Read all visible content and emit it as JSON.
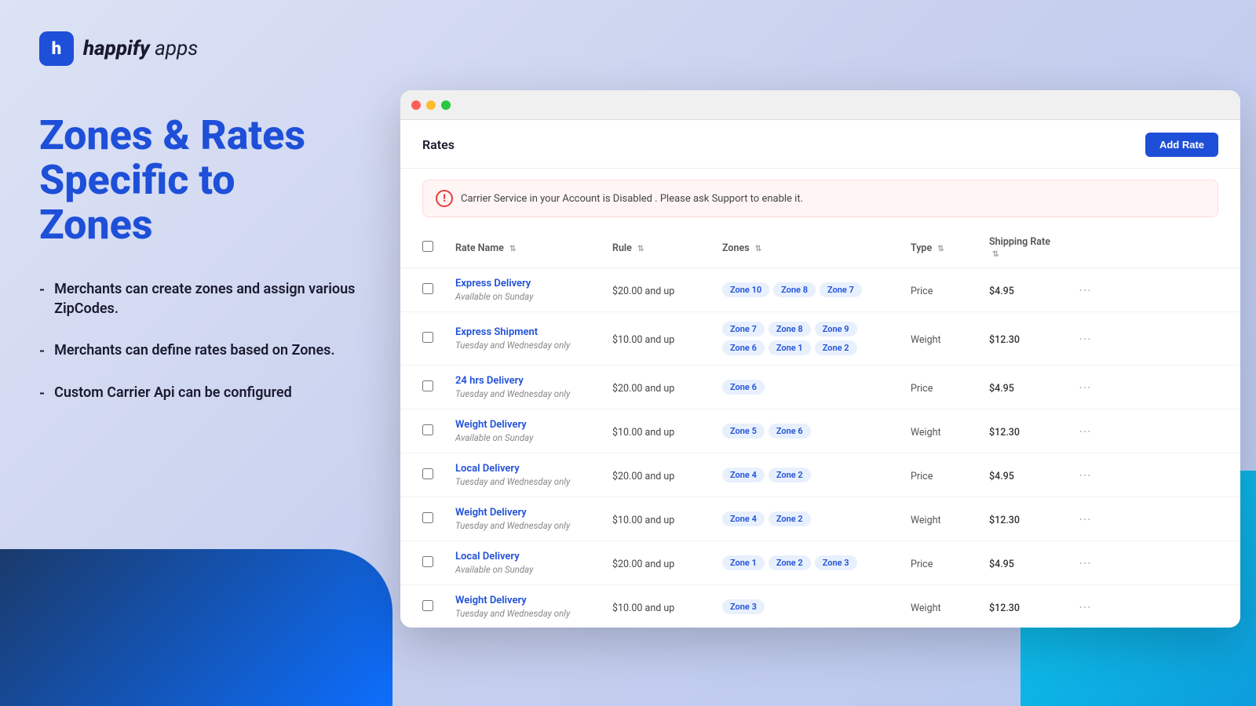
{
  "logo": {
    "icon_letter": "h",
    "brand_name": "happify",
    "brand_suffix": " apps"
  },
  "headline": {
    "line1": "Zones & Rates",
    "line2": "Specific to",
    "line3": "Zones"
  },
  "bullets": [
    "Merchants can create zones and assign various ZipCodes.",
    "Merchants can define rates based on Zones.",
    "Custom Carrier Api can be configured"
  ],
  "browser": {
    "page_title": "Rates",
    "add_rate_label": "Add Rate",
    "alert": "Carrier Service in your Account is Disabled . Please ask Support to enable it.",
    "table": {
      "columns": [
        "Rate Name",
        "Rule",
        "Zones",
        "Type",
        "Shipping Rate"
      ],
      "sort_label": "↕",
      "rows": [
        {
          "name": "Express Delivery",
          "sub": "Available on Sunday",
          "rule": "$20.00 and up",
          "zones": [
            "Zone 10",
            "Zone 8",
            "Zone 7"
          ],
          "type": "Price",
          "rate": "$4.95"
        },
        {
          "name": "Express Shipment",
          "sub": "Tuesday and Wednesday only",
          "rule": "$10.00 and up",
          "zones": [
            "Zone 7",
            "Zone 8",
            "Zone 9",
            "Zone 6",
            "Zone 1",
            "Zone 2"
          ],
          "type": "Weight",
          "rate": "$12.30"
        },
        {
          "name": "24 hrs Delivery",
          "sub": "Tuesday and Wednesday only",
          "rule": "$20.00 and up",
          "zones": [
            "Zone 6"
          ],
          "type": "Price",
          "rate": "$4.95"
        },
        {
          "name": "Weight Delivery",
          "sub": "Available on Sunday",
          "rule": "$10.00 and up",
          "zones": [
            "Zone 5",
            "Zone 6"
          ],
          "type": "Weight",
          "rate": "$12.30"
        },
        {
          "name": "Local Delivery",
          "sub": "Tuesday and Wednesday only",
          "rule": "$20.00 and up",
          "zones": [
            "Zone 4",
            "Zone 2"
          ],
          "type": "Price",
          "rate": "$4.95"
        },
        {
          "name": "Weight Delivery",
          "sub": "Tuesday and Wednesday only",
          "rule": "$10.00 and up",
          "zones": [
            "Zone 4",
            "Zone 2"
          ],
          "type": "Weight",
          "rate": "$12.30"
        },
        {
          "name": "Local Delivery",
          "sub": "Available on Sunday",
          "rule": "$20.00 and up",
          "zones": [
            "Zone 1",
            "Zone 2",
            "Zone 3"
          ],
          "type": "Price",
          "rate": "$4.95"
        },
        {
          "name": "Weight Delivery",
          "sub": "Tuesday and Wednesday only",
          "rule": "$10.00 and up",
          "zones": [
            "Zone 3"
          ],
          "type": "Weight",
          "rate": "$12.30"
        }
      ]
    }
  }
}
